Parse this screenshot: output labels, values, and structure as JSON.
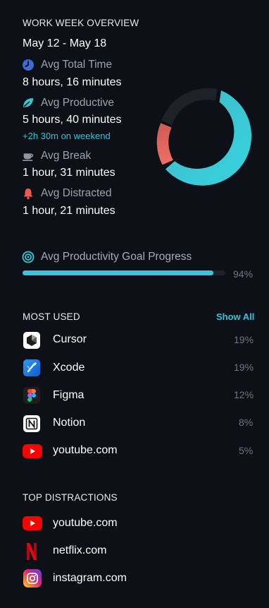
{
  "overview": {
    "title": "WORK WEEK OVERVIEW",
    "date_range": "May 12 - May 18",
    "stats": [
      {
        "icon": "clock-icon",
        "label": "Avg Total Time",
        "value": "8 hours, 16 minutes"
      },
      {
        "icon": "leaf-icon",
        "label": "Avg Productive",
        "value": "5 hours, 40 minutes",
        "extra": "+2h 30m on weekend"
      },
      {
        "icon": "coffee-cup-icon",
        "label": "Avg Break",
        "value": "1 hour, 31 minutes"
      },
      {
        "icon": "bell-icon",
        "label": "Avg Distracted",
        "value": "1 hour, 21 minutes"
      }
    ],
    "colors": {
      "productive": "#36c6d6",
      "distracted": "#e2574c",
      "break": "#1f242c"
    }
  },
  "goal": {
    "icon": "target-icon",
    "label": "Avg Productivity Goal Progress",
    "percent_text": "94%",
    "progress": 0.94
  },
  "most_used": {
    "title": "MOST USED",
    "show_all": "Show All",
    "items": [
      {
        "icon": "cursor-app-icon",
        "name": "Cursor",
        "pct": "19%"
      },
      {
        "icon": "xcode-app-icon",
        "name": "Xcode",
        "pct": "19%"
      },
      {
        "icon": "figma-app-icon",
        "name": "Figma",
        "pct": "12%"
      },
      {
        "icon": "notion-app-icon",
        "name": "Notion",
        "pct": "8%"
      },
      {
        "icon": "youtube-app-icon",
        "name": "youtube.com",
        "pct": "5%"
      }
    ]
  },
  "distractions": {
    "title": "TOP DISTRACTIONS",
    "items": [
      {
        "icon": "youtube-app-icon",
        "name": "youtube.com"
      },
      {
        "icon": "netflix-app-icon",
        "name": "netflix.com"
      },
      {
        "icon": "instagram-app-icon",
        "name": "instagram.com"
      }
    ]
  }
}
